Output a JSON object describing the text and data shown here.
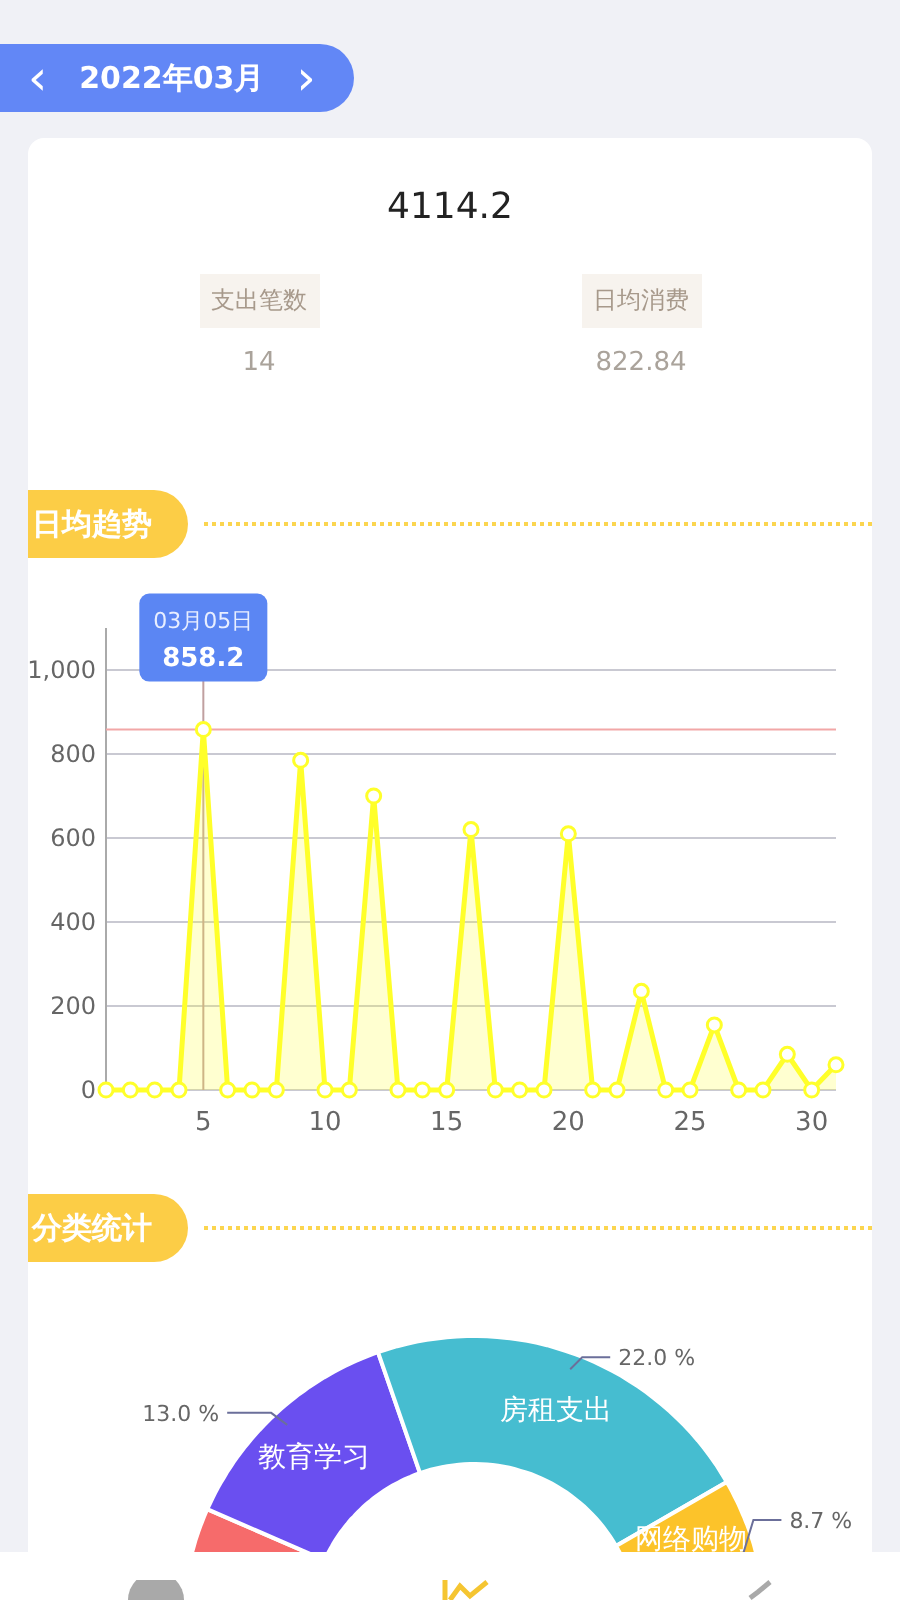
{
  "month_switcher": {
    "prev": "‹",
    "label": "2022年03月",
    "next": "›"
  },
  "summary": {
    "total": "4114.2",
    "stats": [
      {
        "label": "支出笔数",
        "value": "14"
      },
      {
        "label": "日均消费",
        "value": "822.84"
      }
    ]
  },
  "trend": {
    "title": "日均趋势",
    "chart_data": {
      "type": "area",
      "x": [
        1,
        2,
        3,
        4,
        5,
        6,
        7,
        8,
        9,
        10,
        11,
        12,
        13,
        14,
        15,
        16,
        17,
        18,
        19,
        20,
        21,
        22,
        23,
        24,
        25,
        26,
        27,
        28,
        29,
        30,
        31
      ],
      "series": [
        {
          "color": "#ffff2a",
          "values": [
            0,
            0,
            0,
            0,
            858.2,
            0,
            0,
            0,
            785,
            0,
            0,
            700,
            0,
            0,
            0,
            620,
            0,
            0,
            0,
            610,
            0,
            0,
            235,
            0,
            0,
            155,
            0,
            0,
            85,
            0,
            60
          ]
        }
      ],
      "xlim": [
        1,
        31
      ],
      "ylim": [
        0,
        1100
      ],
      "xticks": [
        5,
        10,
        15,
        20,
        25,
        30
      ],
      "yticks": [
        0,
        200,
        400,
        600,
        800,
        {
          "value": 1000,
          "label": "1,000"
        }
      ],
      "grid": true,
      "ref_lines": [
        {
          "axis": "y",
          "value": 858.2,
          "color": "#f2a7a7"
        },
        {
          "axis": "x",
          "value": 5,
          "color": "#c0a0a0"
        }
      ]
    },
    "tooltip": {
      "date": "03月05日",
      "value": "858.2"
    }
  },
  "categories": {
    "title": "分类统计",
    "cut_slice": {
      "color": "#f66b6b"
    },
    "slices": [
      {
        "label": "教育学习",
        "percent": "13.0 %",
        "color": "#6a4ff0"
      },
      {
        "label": "房租支出",
        "percent": "22.0 %",
        "color": "#46bdd0"
      },
      {
        "label": "网络购物",
        "percent": "8.7 %",
        "color": "#fcc32a"
      }
    ]
  },
  "tab_bar": {
    "tabs": [
      {
        "selected": false
      },
      {
        "selected": true
      },
      {
        "selected": false
      }
    ]
  }
}
